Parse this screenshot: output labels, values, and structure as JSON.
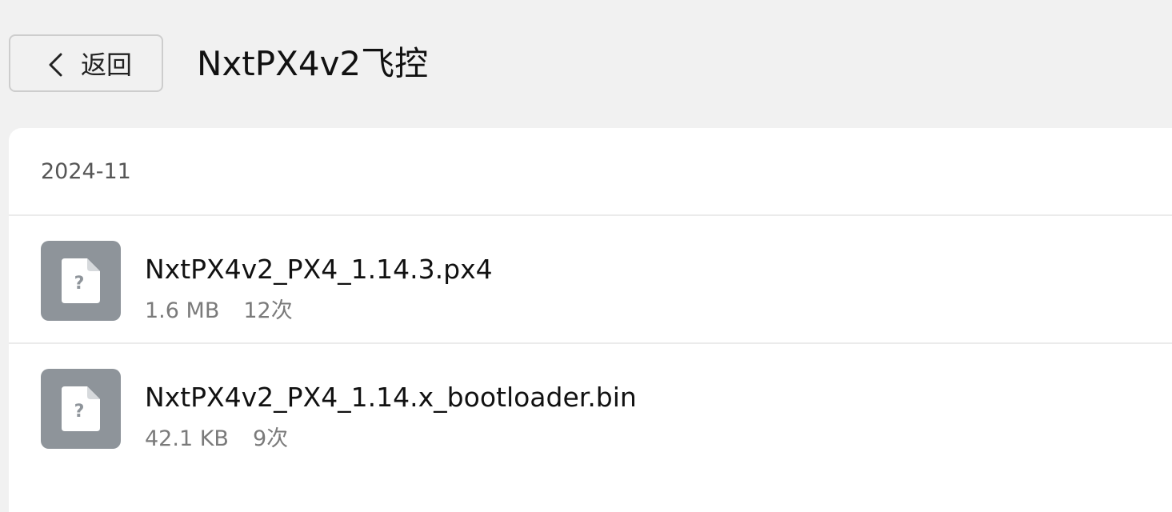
{
  "header": {
    "back_label": "返回",
    "back_icon": "chevron-left-icon",
    "title": "NxtPX4v2飞控"
  },
  "section": {
    "date": "2024-11"
  },
  "files": [
    {
      "name": "NxtPX4v2_PX4_1.14.3.px4",
      "size": "1.6 MB",
      "count": "12次",
      "icon": "unknown-file-icon"
    },
    {
      "name": "NxtPX4v2_PX4_1.14.x_bootloader.bin",
      "size": "42.1 KB",
      "count": "9次",
      "icon": "unknown-file-icon"
    }
  ],
  "colors": {
    "page_background": "#f1f1f1",
    "card_background": "#ffffff",
    "file_icon_background": "#8e949a",
    "meta_text": "#7a7a7a"
  }
}
